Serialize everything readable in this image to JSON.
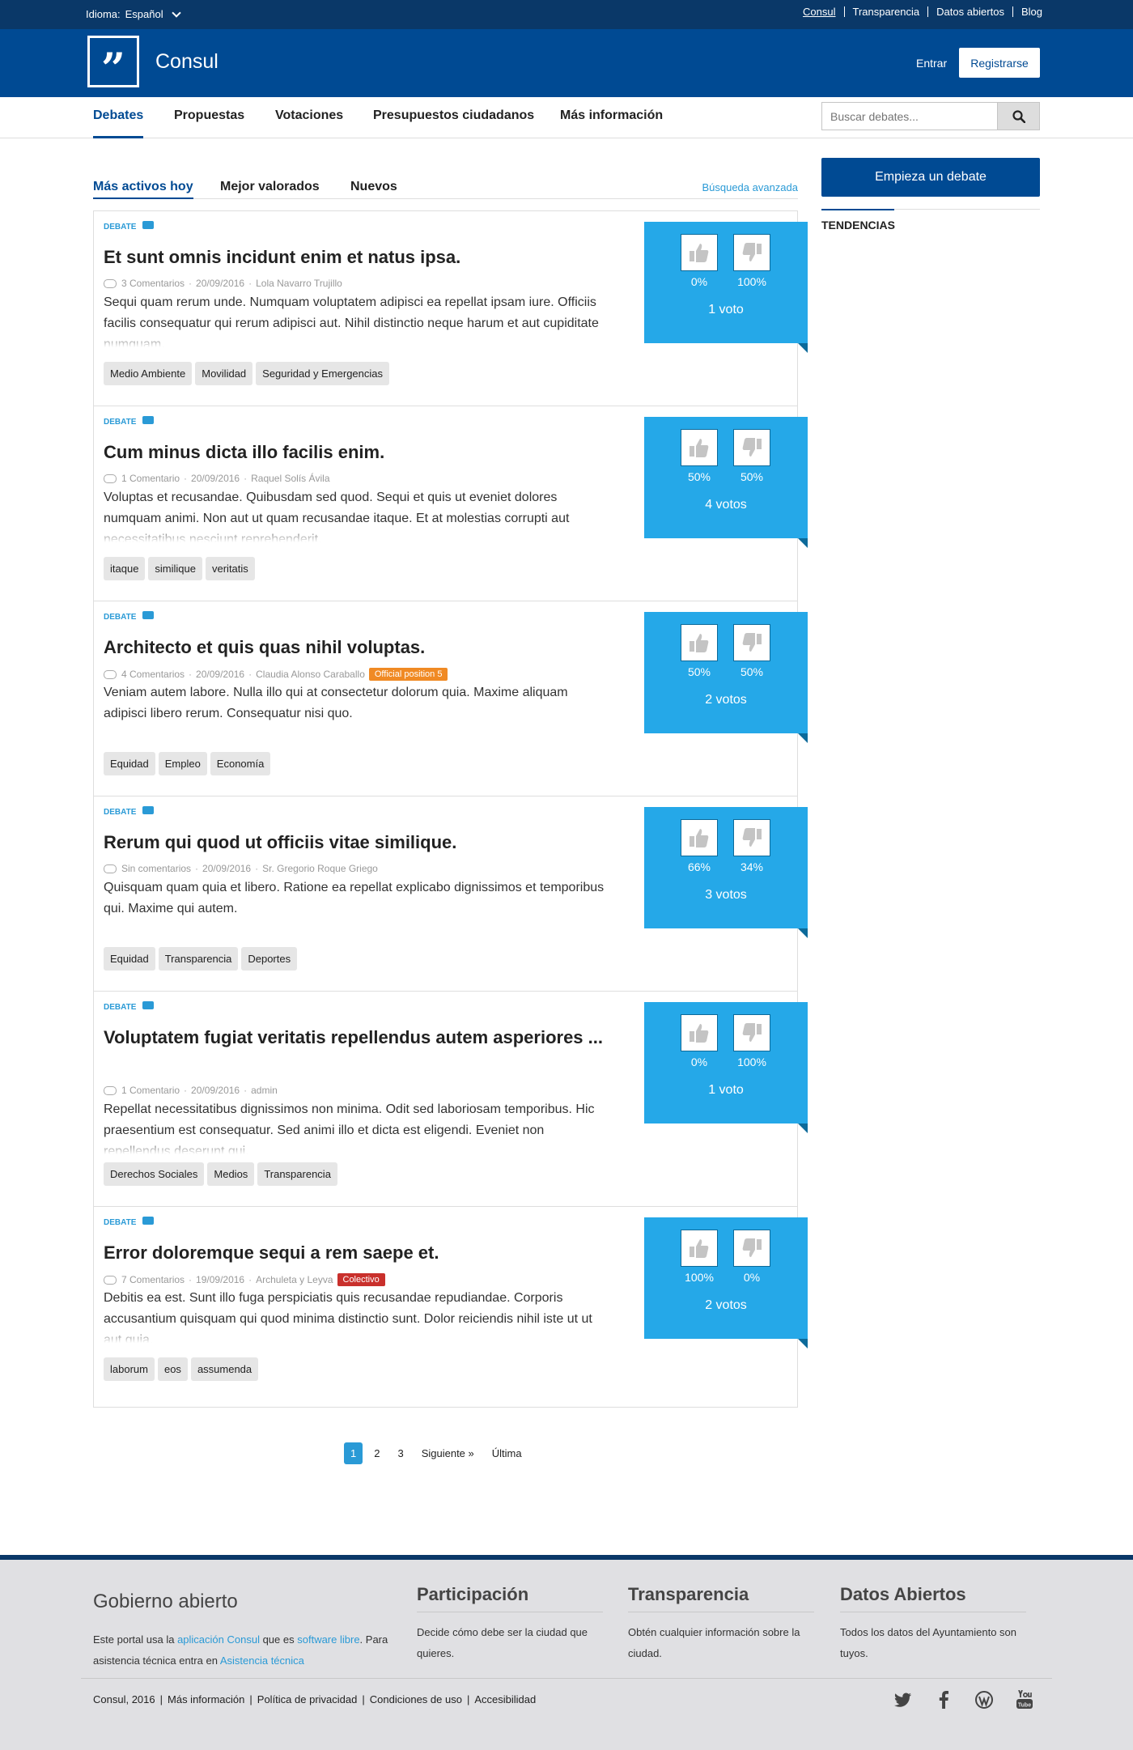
{
  "topbar": {
    "language_label": "Idioma:",
    "language_value": "Español",
    "links": [
      "Consul",
      "Transparencia",
      "Datos abiertos",
      "Blog"
    ]
  },
  "header": {
    "logo_mark": "”",
    "app_name": "Consul",
    "login": "Entrar",
    "register": "Registrarse"
  },
  "nav": {
    "items": [
      "Debates",
      "Propuestas",
      "Votaciones",
      "Presupuestos ciudadanos",
      "Más información"
    ],
    "search_placeholder": "Buscar debates..."
  },
  "subtabs": {
    "items": [
      "Más activos hoy",
      "Mejor valorados",
      "Nuevos"
    ],
    "advanced_search": "Búsqueda avanzada"
  },
  "sidebar": {
    "start_debate": "Empieza un debate",
    "trends_title": "TENDENCIAS"
  },
  "debates": [
    {
      "type": "DEBATE",
      "title": "Et sunt omnis incidunt enim et natus ipsa.",
      "comments": "3 Comentarios",
      "date": "20/09/2016",
      "author": "Lola Navarro Trujillo",
      "badge": "",
      "body": "Sequi quam rerum unde. Numquam voluptatem adipisci ea repellat ipsam iure. Officiis facilis consequatur qui rerum adipisci aut. Nihil distinctio neque harum et aut cupiditate numquam.",
      "tags": [
        "Medio Ambiente",
        "Movilidad",
        "Seguridad y Emergencias"
      ],
      "up_pct": "0%",
      "down_pct": "100%",
      "votes": "1 voto"
    },
    {
      "type": "DEBATE",
      "title": "Cum minus dicta illo facilis enim.",
      "comments": "1 Comentario",
      "date": "20/09/2016",
      "author": "Raquel Solís Ávila",
      "badge": "",
      "body": "Voluptas et recusandae. Quibusdam sed quod. Sequi et quis ut eveniet dolores numquam animi. Non aut ut quam recusandae itaque. Et at molestias corrupti aut necessitatibus nesciunt reprehenderit.",
      "tags": [
        "itaque",
        "similique",
        "veritatis"
      ],
      "up_pct": "50%",
      "down_pct": "50%",
      "votes": "4 votos"
    },
    {
      "type": "DEBATE",
      "title": "Architecto et quis quas nihil voluptas.",
      "comments": "4 Comentarios",
      "date": "20/09/2016",
      "author": "Claudia Alonso Caraballo",
      "badge": "Official position 5",
      "badge_color": "#f08a24",
      "body": "Veniam autem labore. Nulla illo qui at consectetur dolorum quia. Maxime aliquam adipisci libero rerum. Consequatur nisi quo.",
      "tags": [
        "Equidad",
        "Empleo",
        "Economía"
      ],
      "up_pct": "50%",
      "down_pct": "50%",
      "votes": "2 votos"
    },
    {
      "type": "DEBATE",
      "title": "Rerum qui quod ut officiis vitae similique.",
      "comments": "Sin comentarios",
      "date": "20/09/2016",
      "author": "Sr. Gregorio Roque Griego",
      "badge": "",
      "body": "Quisquam quam quia et libero. Ratione ea repellat explicabo dignissimos et temporibus qui. Maxime qui autem.",
      "tags": [
        "Equidad",
        "Transparencia",
        "Deportes"
      ],
      "up_pct": "66%",
      "down_pct": "34%",
      "votes": "3 votos"
    },
    {
      "type": "DEBATE",
      "title": "Voluptatem fugiat veritatis repellendus autem asperiores ...",
      "comments": "1 Comentario",
      "date": "20/09/2016",
      "author": "admin",
      "badge": "",
      "body": "Repellat necessitatibus dignissimos non minima. Odit sed laboriosam temporibus. Hic praesentium est consequatur. Sed animi illo et dicta est eligendi. Eveniet non repellendus deserunt qui.",
      "tags": [
        "Derechos Sociales",
        "Medios",
        "Transparencia"
      ],
      "up_pct": "0%",
      "down_pct": "100%",
      "votes": "1 voto"
    },
    {
      "type": "DEBATE",
      "title": "Error doloremque sequi a rem saepe et.",
      "comments": "7 Comentarios",
      "date": "19/09/2016",
      "author": "Archuleta y Leyva",
      "badge": "Colectivo",
      "badge_color": "#c9302c",
      "body": "Debitis ea est. Sunt illo fuga perspiciatis quis recusandae repudiandae. Corporis accusantium quisquam qui quod minima distinctio sunt. Dolor reiciendis nihil iste ut ut aut quia.",
      "tags": [
        "laborum",
        "eos",
        "assumenda"
      ],
      "up_pct": "100%",
      "down_pct": "0%",
      "votes": "2 votos"
    }
  ],
  "pagination": {
    "pages": [
      "1",
      "2",
      "3"
    ],
    "current": "1",
    "next": "Siguiente »",
    "last": "Última"
  },
  "footer": {
    "title": "Gobierno abierto",
    "desc_1": "Este portal usa la ",
    "desc_link_1": "aplicación Consul",
    "desc_2": " que es ",
    "desc_link_2": "software libre",
    "desc_3": ". Para asistencia técnica entra en ",
    "desc_link_3": "Asistencia técnica",
    "columns": [
      {
        "title": "Participación",
        "text": "Decide cómo debe ser la ciudad que quieres."
      },
      {
        "title": "Transparencia",
        "text": "Obtén cualquier información sobre la ciudad."
      },
      {
        "title": "Datos Abiertos",
        "text": "Todos los datos del Ayuntamiento son tuyos."
      }
    ],
    "copyright": "Consul, 2016",
    "links": [
      "Más información",
      "Política de privacidad",
      "Condiciones de uso",
      "Accesibilidad"
    ],
    "social": [
      "twitter-icon",
      "facebook-icon",
      "wordpress-icon",
      "youtube-icon"
    ]
  },
  "colors": {
    "topbar": "#0a3868",
    "header": "#004a93",
    "vote_box": "#25a8e8",
    "accent": "#2a9ad6"
  }
}
